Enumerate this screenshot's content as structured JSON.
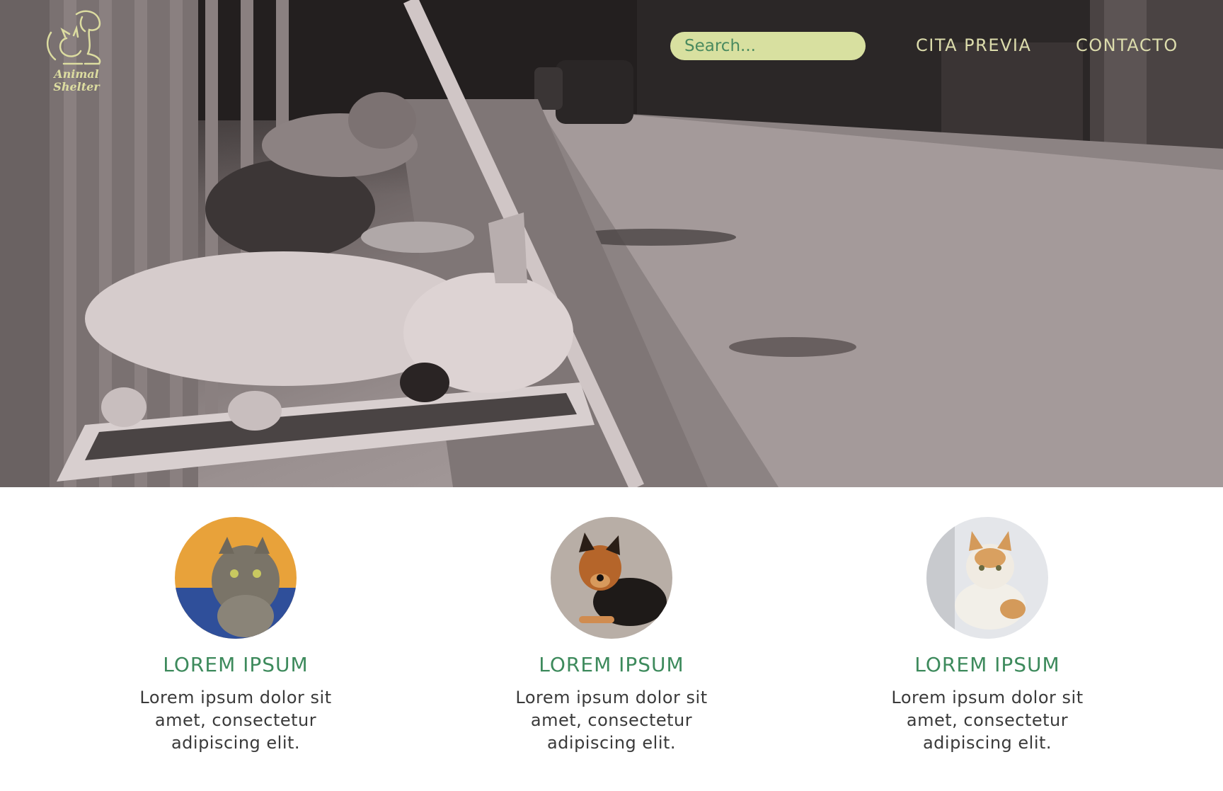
{
  "header": {
    "logo_text": "Animal Shelter",
    "search": {
      "placeholder": "Search...",
      "value": ""
    },
    "nav": {
      "cita_previa": "CITA PREVIA",
      "contacto": "CONTACTO"
    }
  },
  "hero": {
    "image_icon": "sleeping-dogs-street-photo"
  },
  "cards": [
    {
      "image_icon": "tabby-cat-photo",
      "title": "LOREM IPSUM",
      "text": "Lorem ipsum dolor sit amet, consectetur adipiscing elit."
    },
    {
      "image_icon": "dog-photo",
      "title": "LOREM IPSUM",
      "text": "Lorem ipsum dolor sit amet, consectetur adipiscing elit."
    },
    {
      "image_icon": "white-orange-cat-photo",
      "title": "LOREM IPSUM",
      "text": "Lorem ipsum dolor sit amet, consectetur adipiscing elit."
    }
  ],
  "colors": {
    "accent_green": "#3d8a5c",
    "search_bg": "#d8e0a0",
    "nav_text": "#dcdcac",
    "body_text": "#3a3a3a"
  }
}
